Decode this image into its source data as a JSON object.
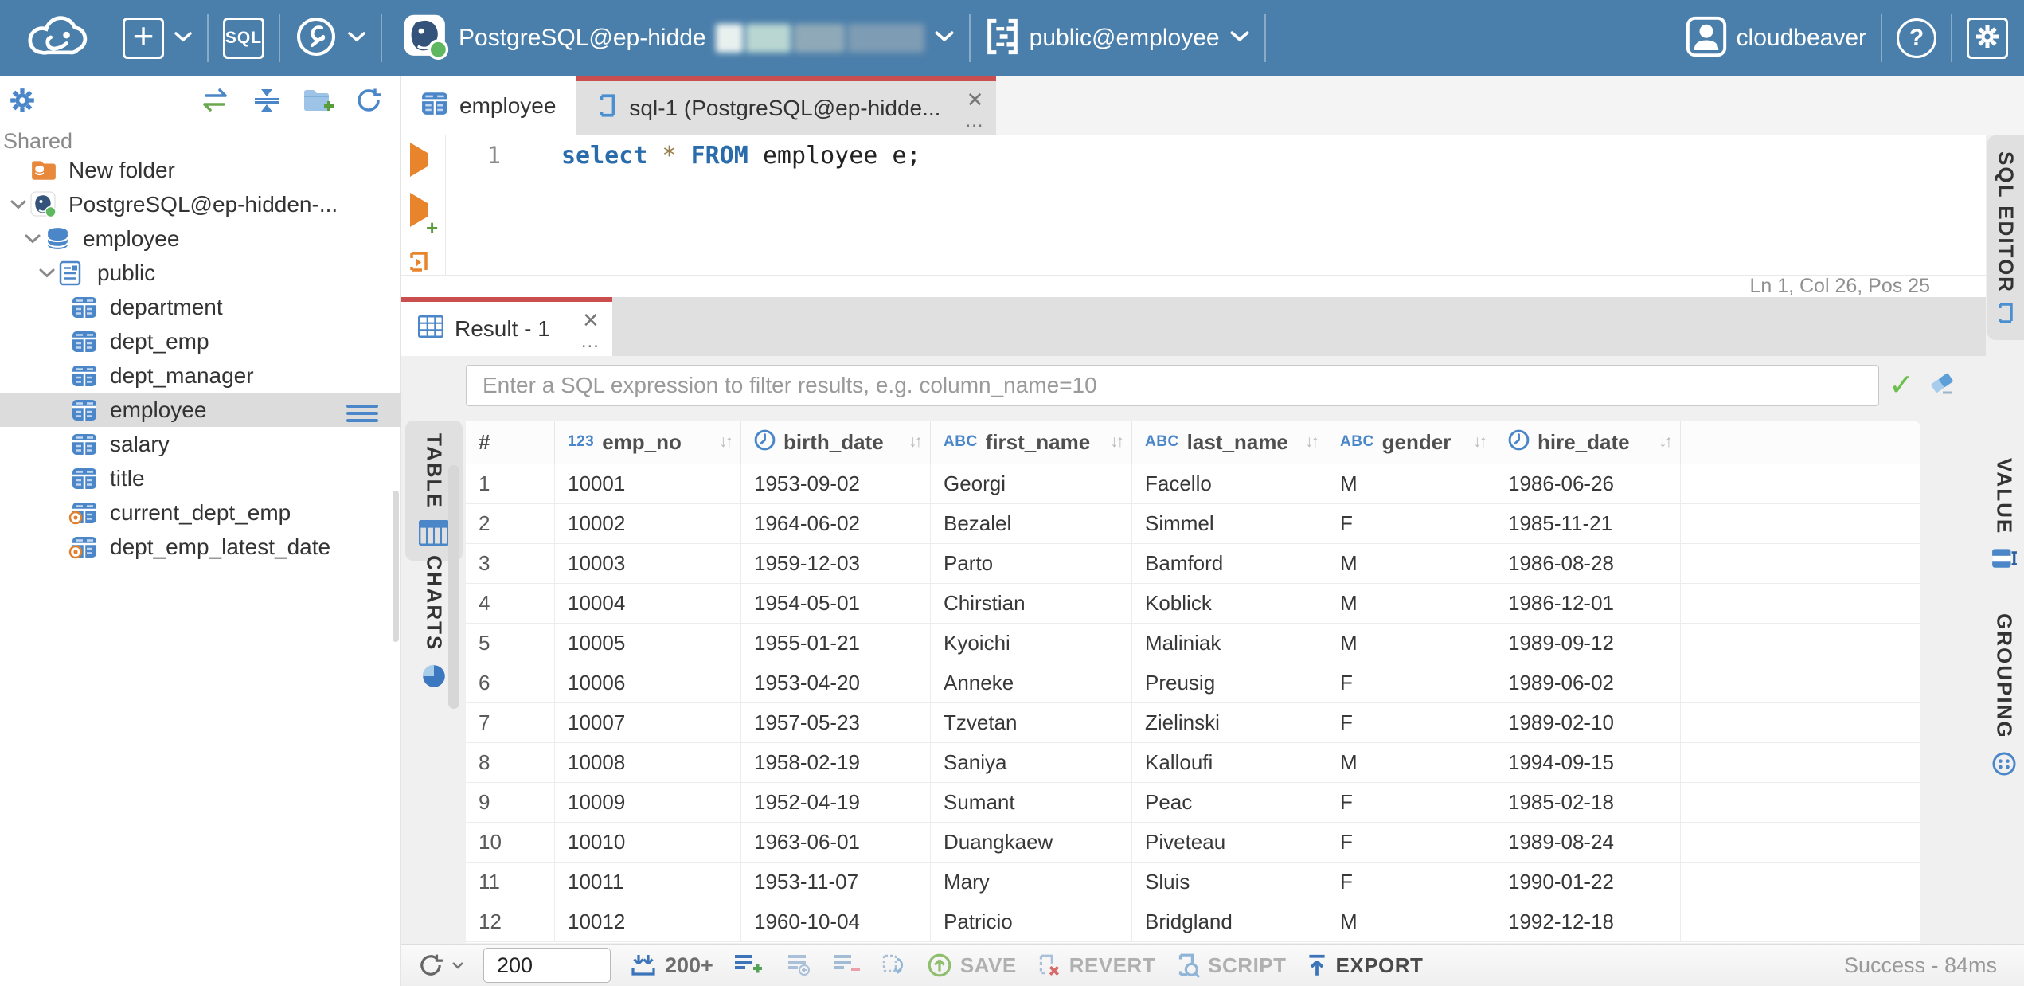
{
  "topbar": {
    "sql_badge": "SQL",
    "connection": {
      "label": "PostgreSQL@ep-hidde"
    },
    "schema": {
      "label": "public@employee"
    },
    "user": {
      "label": "cloudbeaver"
    },
    "help": "?"
  },
  "sidebar": {
    "section": "Shared",
    "tree": [
      {
        "label": "New folder",
        "icon": "folder",
        "indent": 0,
        "chevron": false,
        "selected": false
      },
      {
        "label": "PostgreSQL@ep-hidden-...",
        "icon": "postgres",
        "indent": 1,
        "chevron": true,
        "selected": false
      },
      {
        "label": "employee",
        "icon": "database",
        "indent": 2,
        "chevron": true,
        "selected": false
      },
      {
        "label": "public",
        "icon": "schema",
        "indent": 3,
        "chevron": true,
        "selected": false
      },
      {
        "label": "department",
        "icon": "table",
        "indent": 4,
        "chevron": false,
        "selected": false
      },
      {
        "label": "dept_emp",
        "icon": "table",
        "indent": 4,
        "chevron": false,
        "selected": false
      },
      {
        "label": "dept_manager",
        "icon": "table",
        "indent": 4,
        "chevron": false,
        "selected": false
      },
      {
        "label": "employee",
        "icon": "table",
        "indent": 4,
        "chevron": false,
        "selected": true
      },
      {
        "label": "salary",
        "icon": "table",
        "indent": 4,
        "chevron": false,
        "selected": false
      },
      {
        "label": "title",
        "icon": "table",
        "indent": 4,
        "chevron": false,
        "selected": false
      },
      {
        "label": "current_dept_emp",
        "icon": "view",
        "indent": 4,
        "chevron": false,
        "selected": false
      },
      {
        "label": "dept_emp_latest_date",
        "icon": "view",
        "indent": 4,
        "chevron": false,
        "selected": false
      }
    ]
  },
  "tabs": {
    "table_tab": "employee",
    "sql_tab": "sql-1 (PostgreSQL@ep-hidde...",
    "close": "✕",
    "more": "..."
  },
  "editor": {
    "line_number": "1",
    "code": [
      {
        "text": "select",
        "cls": "kw"
      },
      {
        "text": " ",
        "cls": "pl"
      },
      {
        "text": "*",
        "cls": "star"
      },
      {
        "text": " ",
        "cls": "pl"
      },
      {
        "text": "FROM",
        "cls": "kw"
      },
      {
        "text": " employee e;",
        "cls": "pl"
      }
    ],
    "status": "Ln 1, Col 26, Pos 25",
    "side_tab": "SQL EDITOR"
  },
  "result": {
    "tab": "Result - 1",
    "filter_placeholder": "Enter a SQL expression to filter results, e.g. column_name=10",
    "left_tabs": [
      {
        "label": "TABLE",
        "icon": "grid",
        "selected": true
      },
      {
        "label": "CHARTS",
        "icon": "pie",
        "selected": false
      }
    ],
    "right_tabs": [
      {
        "label": "VALUE",
        "icon": "value"
      },
      {
        "label": "GROUPING",
        "icon": "grouping"
      }
    ],
    "grid": {
      "columns": [
        {
          "name": "#",
          "type": "index"
        },
        {
          "name": "emp_no",
          "type": "number"
        },
        {
          "name": "birth_date",
          "type": "date"
        },
        {
          "name": "first_name",
          "type": "string"
        },
        {
          "name": "last_name",
          "type": "string"
        },
        {
          "name": "gender",
          "type": "string"
        },
        {
          "name": "hire_date",
          "type": "date"
        }
      ],
      "rows": [
        [
          "1",
          "10001",
          "1953-09-02",
          "Georgi",
          "Facello",
          "M",
          "1986-06-26"
        ],
        [
          "2",
          "10002",
          "1964-06-02",
          "Bezalel",
          "Simmel",
          "F",
          "1985-11-21"
        ],
        [
          "3",
          "10003",
          "1959-12-03",
          "Parto",
          "Bamford",
          "M",
          "1986-08-28"
        ],
        [
          "4",
          "10004",
          "1954-05-01",
          "Chirstian",
          "Koblick",
          "M",
          "1986-12-01"
        ],
        [
          "5",
          "10005",
          "1955-01-21",
          "Kyoichi",
          "Maliniak",
          "M",
          "1989-09-12"
        ],
        [
          "6",
          "10006",
          "1953-04-20",
          "Anneke",
          "Preusig",
          "F",
          "1989-06-02"
        ],
        [
          "7",
          "10007",
          "1957-05-23",
          "Tzvetan",
          "Zielinski",
          "F",
          "1989-02-10"
        ],
        [
          "8",
          "10008",
          "1958-02-19",
          "Saniya",
          "Kalloufi",
          "M",
          "1994-09-15"
        ],
        [
          "9",
          "10009",
          "1952-04-19",
          "Sumant",
          "Peac",
          "F",
          "1985-02-18"
        ],
        [
          "10",
          "10010",
          "1963-06-01",
          "Duangkaew",
          "Piveteau",
          "F",
          "1989-08-24"
        ],
        [
          "11",
          "10011",
          "1953-11-07",
          "Mary",
          "Sluis",
          "F",
          "1990-01-22"
        ],
        [
          "12",
          "10012",
          "1960-10-04",
          "Patricio",
          "Bridgland",
          "M",
          "1992-12-18"
        ]
      ]
    }
  },
  "toolbar": {
    "rows_value": "200",
    "fetch_label": "200+",
    "save": "SAVE",
    "revert": "REVERT",
    "script": "SCRIPT",
    "export": "EXPORT",
    "status": "Success - 84ms"
  },
  "colors": {
    "topbar": "#4b7fab",
    "accent_red": "#cb4e4e",
    "icon_blue": "#4a86c8",
    "success_gray": "#9a9a9a"
  }
}
